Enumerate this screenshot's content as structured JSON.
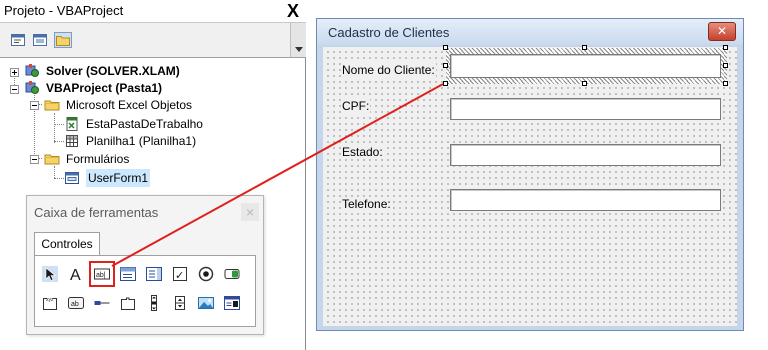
{
  "project_explorer": {
    "title": "Projeto - VBAProject",
    "close_label": "X",
    "toolbar": {
      "buttons": [
        {
          "icon": "view-code-icon"
        },
        {
          "icon": "view-object-icon"
        },
        {
          "icon": "toggle-folders-icon"
        }
      ]
    },
    "tree": [
      {
        "label": "Solver (SOLVER.XLAM)",
        "icon": "vba-project-icon",
        "expander": "+"
      },
      {
        "label": "VBAProject (Pasta1)",
        "icon": "vba-project-icon",
        "expander": "-"
      },
      {
        "label": "Microsoft Excel Objetos",
        "icon": "folder-icon",
        "expander": "-"
      },
      {
        "label": "EstaPastaDeTrabalho",
        "icon": "workbook-icon"
      },
      {
        "label": "Planilha1 (Planilha1)",
        "icon": "worksheet-icon"
      },
      {
        "label": "Formulários",
        "icon": "folder-icon",
        "expander": "-"
      },
      {
        "label": "UserForm1",
        "icon": "userform-icon"
      }
    ]
  },
  "toolbox": {
    "title": "Caixa de ferramentas",
    "tab": "Controles",
    "tools_row1": [
      {
        "icon": "select-objects-icon"
      },
      {
        "icon": "label-icon",
        "glyph": "A"
      },
      {
        "icon": "textbox-icon",
        "glyph": "ab|",
        "highlighted": true
      },
      {
        "icon": "combobox-icon"
      },
      {
        "icon": "listbox-icon"
      },
      {
        "icon": "checkbox-icon",
        "glyph": "✓"
      },
      {
        "icon": "optionbutton-icon"
      },
      {
        "icon": "togglebutton-icon"
      }
    ],
    "tools_row2": [
      {
        "icon": "frame-icon",
        "glyph": "xyz"
      },
      {
        "icon": "commandbutton-icon",
        "glyph": "ab"
      },
      {
        "icon": "tabstrip-icon"
      },
      {
        "icon": "multipage-icon"
      },
      {
        "icon": "scrollbar-icon"
      },
      {
        "icon": "spinbutton-icon"
      },
      {
        "icon": "image-icon"
      },
      {
        "icon": "refedit-icon"
      }
    ]
  },
  "userform": {
    "title": "Cadastro de Clientes",
    "fields": [
      {
        "label": "Nome do Cliente:",
        "value": ""
      },
      {
        "label": "CPF:",
        "value": ""
      },
      {
        "label": "Estado:",
        "value": ""
      },
      {
        "label": "Telefone:",
        "value": ""
      }
    ]
  },
  "colors": {
    "highlight": "#e0201c",
    "form_title_bg": "#c9d9ee",
    "close_button": "#c6412b"
  }
}
